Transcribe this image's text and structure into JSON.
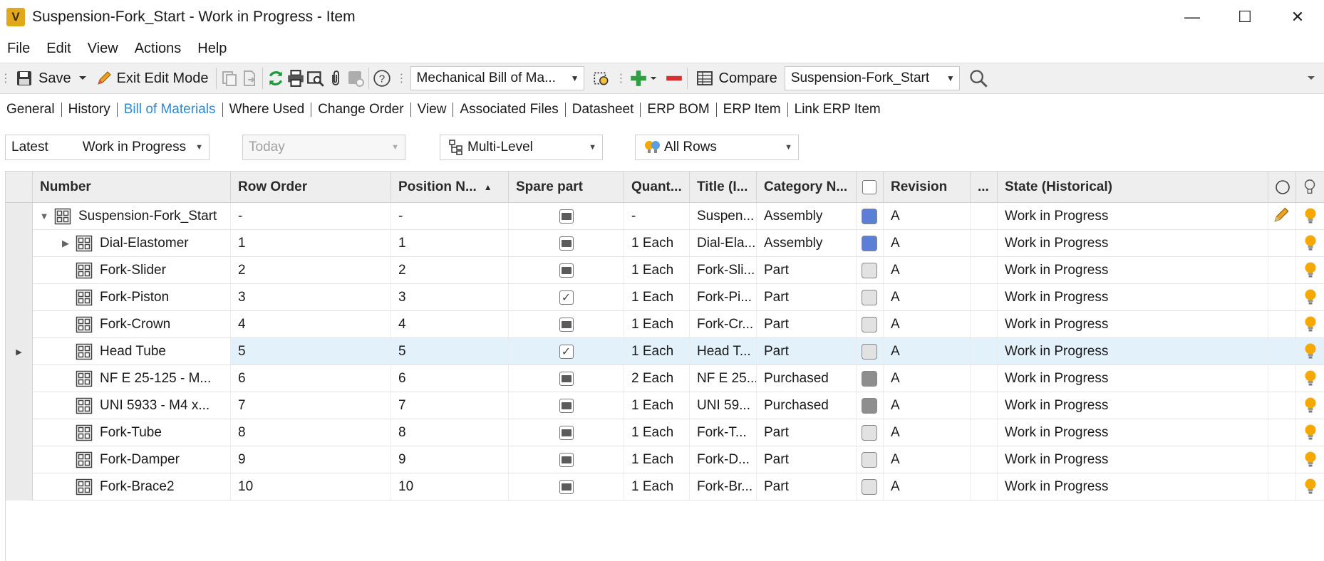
{
  "window": {
    "app_icon_letter": "V",
    "title": "Suspension-Fork_Start - Work in Progress - Item",
    "minimize": "—",
    "maximize": "☐",
    "close": "✕"
  },
  "menu": [
    "File",
    "Edit",
    "View",
    "Actions",
    "Help"
  ],
  "toolbar": {
    "save_label": "Save",
    "exit_edit_label": "Exit Edit Mode",
    "bom_view_combo": "Mechanical Bill of Ma...",
    "compare_label": "Compare",
    "compare_combo": "Suspension-Fork_Start"
  },
  "tabs": [
    {
      "label": "General",
      "active": false
    },
    {
      "label": "History",
      "active": false
    },
    {
      "label": "Bill of Materials",
      "active": true
    },
    {
      "label": "Where Used",
      "active": false
    },
    {
      "label": "Change Order",
      "active": false
    },
    {
      "label": "View",
      "active": false
    },
    {
      "label": "Associated Files",
      "active": false
    },
    {
      "label": "Datasheet",
      "active": false
    },
    {
      "label": "ERP BOM",
      "active": false
    },
    {
      "label": "ERP Item",
      "active": false
    },
    {
      "label": "Link ERP Item",
      "active": false
    }
  ],
  "filters": {
    "version_prefix": "Latest",
    "version_state": "Work in Progress",
    "date": "Today",
    "structure": "Multi-Level",
    "rows": "All Rows"
  },
  "columns": {
    "number": "Number",
    "row_order": "Row Order",
    "position": "Position N...",
    "spare": "Spare part",
    "quantity": "Quant...",
    "title": "Title (I...",
    "category": "Category N...",
    "revision": "Revision",
    "more": "...",
    "state": "State (Historical)"
  },
  "colors": {
    "assembly": "#5b7fd6",
    "part": "#e2e2e2",
    "purchased": "#8e8e8e",
    "bulb": "#f5a800",
    "active_tab": "#2e8ad8"
  },
  "rows": [
    {
      "number": "Suspension-Fork_Start",
      "row_order": "-",
      "position": "-",
      "spare": "indet",
      "quantity": "-",
      "title": "Suspen...",
      "category": "Assembly",
      "cat_color": "assembly",
      "revision": "A",
      "state": "Work in Progress",
      "level": 0,
      "expander": "▼",
      "edit": true,
      "selected": false
    },
    {
      "number": "Dial-Elastomer",
      "row_order": "1",
      "position": "1",
      "spare": "indet",
      "quantity": "1 Each",
      "title": "Dial-Ela...",
      "category": "Assembly",
      "cat_color": "assembly",
      "revision": "A",
      "state": "Work in Progress",
      "level": 1,
      "expander": "▶",
      "edit": false,
      "selected": false
    },
    {
      "number": "Fork-Slider",
      "row_order": "2",
      "position": "2",
      "spare": "indet",
      "quantity": "1 Each",
      "title": "Fork-Sli...",
      "category": "Part",
      "cat_color": "part",
      "revision": "A",
      "state": "Work in Progress",
      "level": 1,
      "expander": "",
      "edit": false,
      "selected": false
    },
    {
      "number": "Fork-Piston",
      "row_order": "3",
      "position": "3",
      "spare": "checked",
      "quantity": "1 Each",
      "title": "Fork-Pi...",
      "category": "Part",
      "cat_color": "part",
      "revision": "A",
      "state": "Work in Progress",
      "level": 1,
      "expander": "",
      "edit": false,
      "selected": false
    },
    {
      "number": "Fork-Crown",
      "row_order": "4",
      "position": "4",
      "spare": "indet",
      "quantity": "1 Each",
      "title": "Fork-Cr...",
      "category": "Part",
      "cat_color": "part",
      "revision": "A",
      "state": "Work in Progress",
      "level": 1,
      "expander": "",
      "edit": false,
      "selected": false
    },
    {
      "number": "Head Tube",
      "row_order": "5",
      "position": "5",
      "spare": "checked",
      "quantity": "1 Each",
      "title": "Head T...",
      "category": "Part",
      "cat_color": "part",
      "revision": "A",
      "state": "Work in Progress",
      "level": 1,
      "expander": "",
      "edit": false,
      "selected": true
    },
    {
      "number": "NF E 25-125 - M...",
      "row_order": "6",
      "position": "6",
      "spare": "indet",
      "quantity": "2 Each",
      "title": "NF E 25...",
      "category": "Purchased",
      "cat_color": "purchased",
      "revision": "A",
      "state": "Work in Progress",
      "level": 1,
      "expander": "",
      "edit": false,
      "selected": false
    },
    {
      "number": "UNI 5933 - M4 x...",
      "row_order": "7",
      "position": "7",
      "spare": "indet",
      "quantity": "1 Each",
      "title": "UNI 59...",
      "category": "Purchased",
      "cat_color": "purchased",
      "revision": "A",
      "state": "Work in Progress",
      "level": 1,
      "expander": "",
      "edit": false,
      "selected": false
    },
    {
      "number": "Fork-Tube",
      "row_order": "8",
      "position": "8",
      "spare": "indet",
      "quantity": "1 Each",
      "title": "Fork-T...",
      "category": "Part",
      "cat_color": "part",
      "revision": "A",
      "state": "Work in Progress",
      "level": 1,
      "expander": "",
      "edit": false,
      "selected": false
    },
    {
      "number": "Fork-Damper",
      "row_order": "9",
      "position": "9",
      "spare": "indet",
      "quantity": "1 Each",
      "title": "Fork-D...",
      "category": "Part",
      "cat_color": "part",
      "revision": "A",
      "state": "Work in Progress",
      "level": 1,
      "expander": "",
      "edit": false,
      "selected": false
    },
    {
      "number": "Fork-Brace2",
      "row_order": "10",
      "position": "10",
      "spare": "indet",
      "quantity": "1 Each",
      "title": "Fork-Br...",
      "category": "Part",
      "cat_color": "part",
      "revision": "A",
      "state": "Work in Progress",
      "level": 1,
      "expander": "",
      "edit": false,
      "selected": false
    }
  ]
}
